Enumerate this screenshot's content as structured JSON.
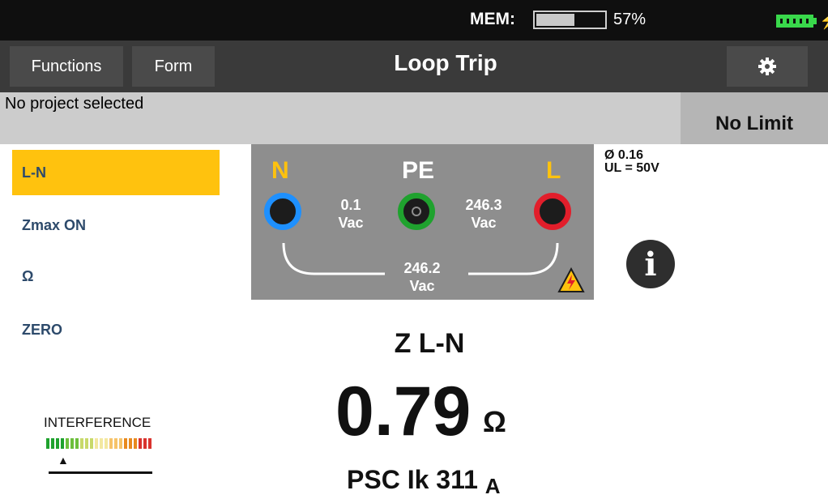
{
  "status": {
    "mem_label": "MEM:",
    "mem_percent_text": "57%",
    "mem_fill_fraction": 0.57,
    "battery_icon": "battery-charging-icon",
    "charge_icon": "lightning-icon",
    "battery_color": "#39d84b"
  },
  "titlebar": {
    "functions_label": "Functions",
    "form_label": "Form",
    "title": "Loop Trip",
    "settings_icon": "gear-icon"
  },
  "project": {
    "text": "No project selected",
    "limit_label": "No Limit"
  },
  "menu": {
    "items": [
      {
        "label": "L-N",
        "active": true
      },
      {
        "label": "Zmax ON",
        "active": false
      },
      {
        "label": "Ω",
        "active": false
      },
      {
        "label": "ZERO",
        "active": false
      }
    ],
    "active_color": "#ffc20e"
  },
  "terminals": {
    "n_label": "N",
    "pe_label": "PE",
    "l_label": "L",
    "n_pe_value": "0.1",
    "pe_l_value": "246.3",
    "n_l_value": "246.2",
    "unit": "Vac",
    "colors": {
      "n": "#1e90ff",
      "pe": "#1fa22e",
      "l": "#e21e2b",
      "label_yellow": "#ffc20e"
    },
    "warning_icon": "high-voltage-warning-icon"
  },
  "phase_info": {
    "line1": "Ø 0.16",
    "line2": "UL = 50V"
  },
  "info_icon": "info-icon",
  "result": {
    "measure_label": "Z L-N",
    "value": "0.79",
    "unit": "Ω",
    "psc_label": "PSC Ik 311",
    "psc_unit": "A"
  },
  "interference": {
    "label": "INTERFERENCE",
    "scale_colors": [
      "#1fa22e",
      "#6cbf3c",
      "#c8d96a",
      "#f3e8a0",
      "#f6c36a",
      "#e8891e",
      "#d9332e"
    ]
  }
}
